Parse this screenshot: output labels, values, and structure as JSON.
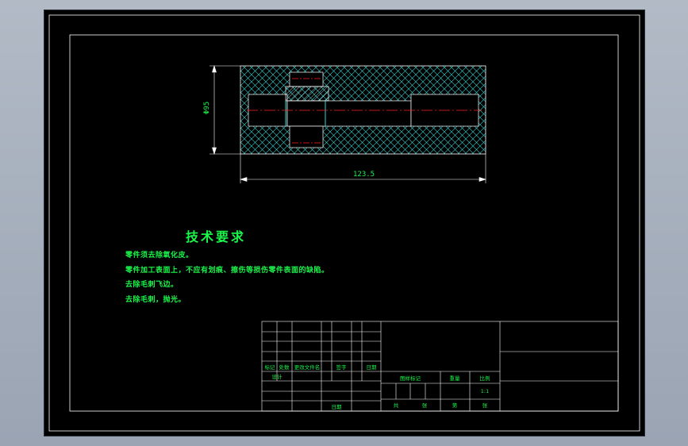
{
  "drawing": {
    "dimension_diameter": "Φ95",
    "dimension_length": "123.5"
  },
  "tech_requirements": {
    "title": "技术要求",
    "lines": [
      "零件须去除氧化皮。",
      "零件加工表面上，不应有划痕、擦伤等损伤零件表面的缺陷。",
      "去除毛刺飞边。",
      "去除毛刺，抛光。"
    ]
  },
  "title_block": {
    "revision_headers": [
      "标记",
      "处数",
      "更改文件名",
      "签字",
      "日期"
    ],
    "design_label": "设计",
    "date_label": "日期",
    "stage_label": "图样标记",
    "weight_label": "重量",
    "scale_label": "比例",
    "scale_value": "1:1",
    "total_label": "共",
    "sheet_label": "张",
    "page_label": "第",
    "page_sheet_label": "张"
  },
  "colors": {
    "sheet_bg": "#000000",
    "line_white": "#ffffff",
    "text_green": "#19f54a",
    "center_red": "#ff2020",
    "hatch_cyan": "#2fd6d6"
  }
}
